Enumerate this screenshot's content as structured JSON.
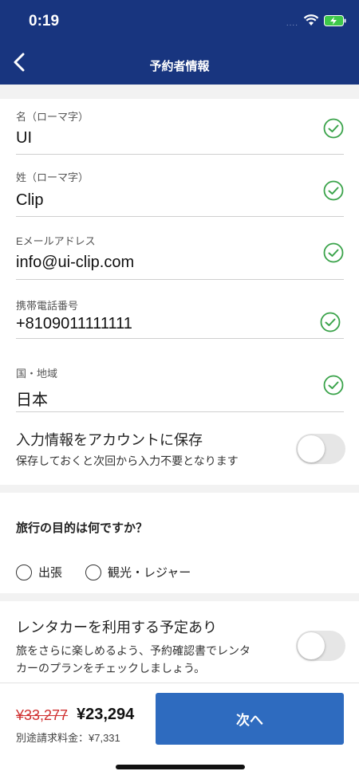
{
  "status_bar": {
    "time": "0:19",
    "signal": "....",
    "icons": [
      "wifi-icon",
      "battery-charging-icon"
    ]
  },
  "nav": {
    "title": "予約者情報",
    "back_icon": "chevron-left-icon"
  },
  "form": {
    "fields": [
      {
        "label": "名（ローマ字）",
        "value": "UI"
      },
      {
        "label": "姓（ローマ字）",
        "value": "Clip"
      },
      {
        "label": "Eメールアドレス",
        "value": "info@ui-clip.com"
      },
      {
        "label": "携帯電話番号",
        "value": "+8109011111111"
      },
      {
        "label": "国・地域",
        "value": "日本"
      }
    ],
    "save_toggle": {
      "title": "入力情報をアカウントに保存",
      "subtitle": "保存しておくと次回から入力不要となります",
      "on": false
    }
  },
  "purpose": {
    "question": "旅行の目的は何ですか？",
    "options": [
      "出張",
      "観光・レジャー"
    ]
  },
  "rental": {
    "title": "レンタカーを利用する予定あり",
    "subtitle_line1": "旅をさらに楽しめるよう、予約確認書でレンタ",
    "subtitle_line2": "カーのプランをチェックしましょう。",
    "on": false
  },
  "footer": {
    "old_price": "¥33,277",
    "new_price": "¥23,294",
    "extra_fee": "別途請求料金：¥7,331",
    "next_label": "次へ"
  },
  "colors": {
    "header": "#18357f",
    "button": "#2e6bbf",
    "check": "#3aa34a",
    "old_price": "#d03030"
  }
}
